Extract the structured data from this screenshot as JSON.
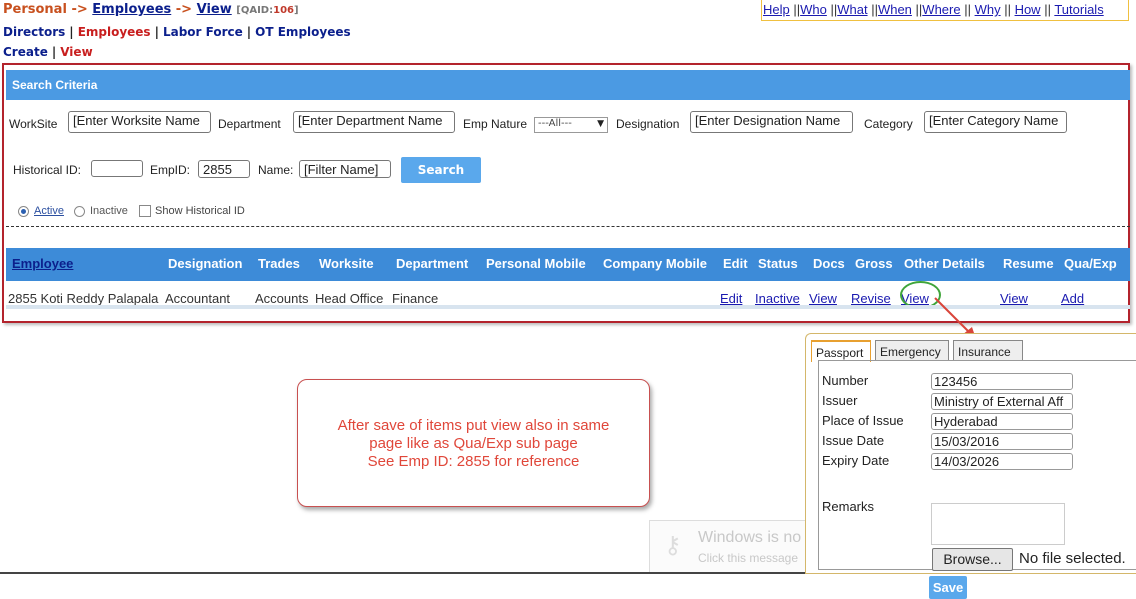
{
  "breadcrumb": {
    "personal": "Personal",
    "arrow": "->",
    "employees": "Employees",
    "view": "View",
    "qaid_prefix": "[QAID:",
    "qaid": "106",
    "qaid_suffix": "]"
  },
  "topmenu": [
    "Help",
    "Who",
    "What",
    "When",
    "Where",
    "Why",
    "How",
    "Tutorials"
  ],
  "nav1": [
    "Directors",
    "Employees",
    "Labor Force",
    "OT Employees"
  ],
  "nav2": [
    "Create",
    "View"
  ],
  "search": {
    "title": "Search Criteria",
    "worksite_label": "WorkSite",
    "worksite_value": "[Enter Worksite Name",
    "department_label": "Department",
    "department_value": "[Enter Department Name",
    "emp_nature_label": "Emp Nature",
    "emp_nature_value": "---All---",
    "designation_label": "Designation",
    "designation_value": "[Enter Designation Name",
    "category_label": "Category",
    "category_value": "[Enter Category Name",
    "historical_label": "Historical ID:",
    "historical_value": "",
    "empid_label": "EmpID:",
    "empid_value": "2855",
    "name_label": "Name:",
    "name_value": "[Filter Name]",
    "button": "Search",
    "active_label": "Active",
    "inactive_label": "Inactive",
    "show_hist_label": "Show Historical ID"
  },
  "table": {
    "headers": [
      "Employee",
      "Designation",
      "Trades",
      "Worksite",
      "Department",
      "Personal Mobile",
      "Company Mobile",
      "Edit",
      "Status",
      "Docs",
      "Gross",
      "Other Details",
      "Resume",
      "Qua/Exp"
    ],
    "row": {
      "employee": "2855 Koti Reddy Palapala",
      "designation": "Accountant",
      "trades": "Accounts",
      "worksite": "Head Office",
      "department": "Finance",
      "personal_mobile": "",
      "company_mobile": "",
      "edit": "Edit",
      "status": "Inactive",
      "docs": "View",
      "gross": "Revise",
      "other_details": "View",
      "resume": "View",
      "qua_exp": "Add"
    }
  },
  "note": {
    "line1": "After save of items put view also in same",
    "line2": "page like as Qua/Exp sub page",
    "line3": "See Emp ID: 2855 for reference"
  },
  "ghost": {
    "line1": "Windows is no",
    "line2": "Click this message"
  },
  "subpanel": {
    "tabs": [
      "Passport",
      "Emergency",
      "Insurance"
    ],
    "fields": [
      {
        "label": "Number",
        "value": "123456"
      },
      {
        "label": "Issuer",
        "value": "Ministry of External Aff"
      },
      {
        "label": "Place of Issue",
        "value": "Hyderabad"
      },
      {
        "label": "Issue Date",
        "value": "15/03/2016"
      },
      {
        "label": "Expiry Date",
        "value": "14/03/2026"
      }
    ],
    "remarks_label": "Remarks",
    "browse": "Browse...",
    "nofile": "No file selected.",
    "save": "Save"
  },
  "colors": {
    "header_blue": "#4b9ae3",
    "table_blue": "#3d8bd8",
    "panel_border": "#b3232c",
    "note_text": "#e0473a",
    "highlight": "#3fa53a"
  }
}
